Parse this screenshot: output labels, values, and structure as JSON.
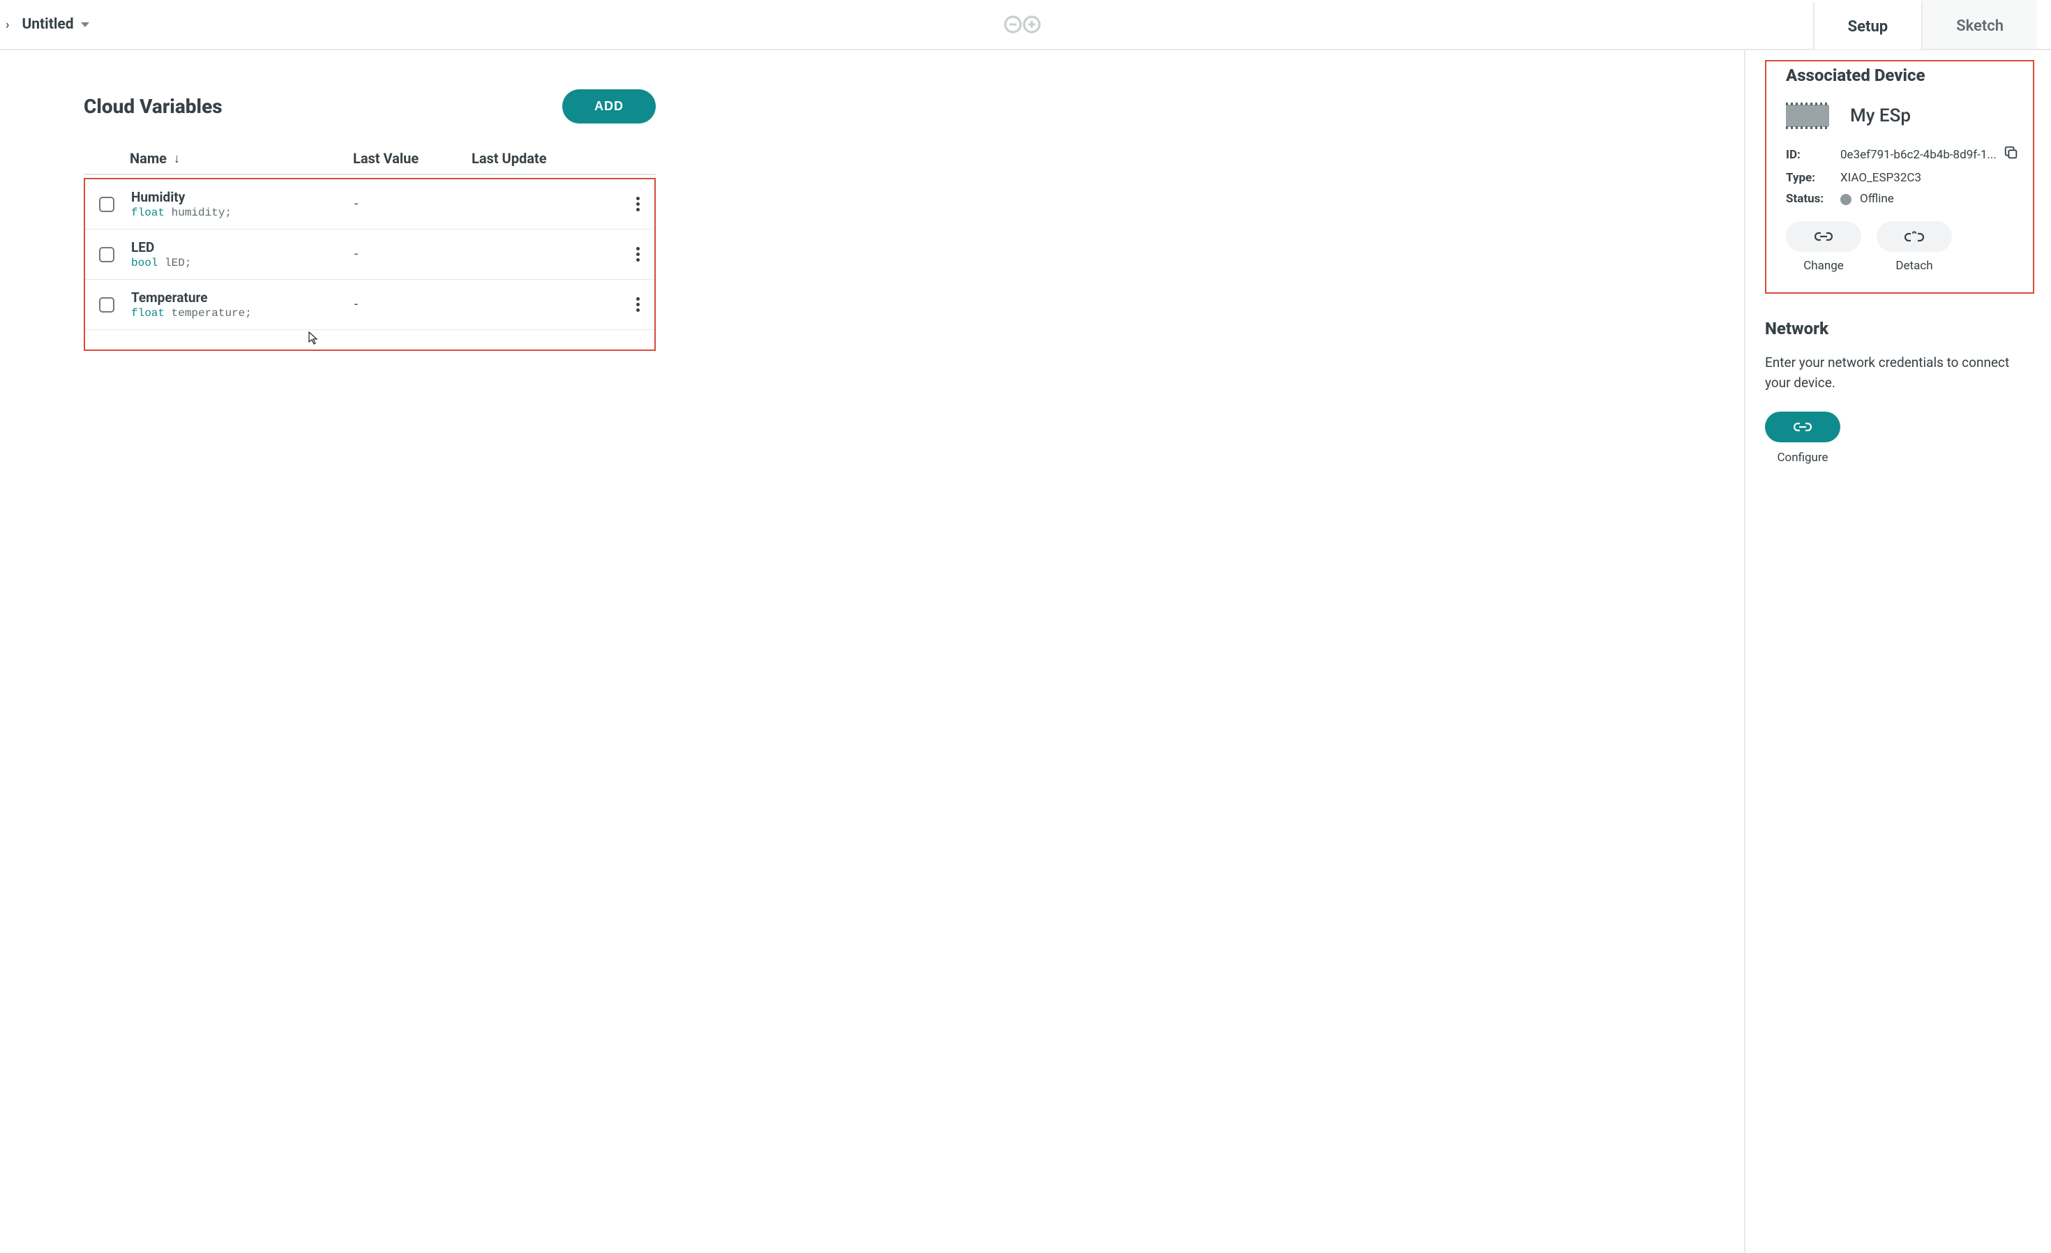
{
  "breadcrumb": {
    "title": "Untitled"
  },
  "tabs": {
    "setup": "Setup",
    "sketch": "Sketch"
  },
  "main": {
    "section_title": "Cloud Variables",
    "add_button": "ADD",
    "columns": {
      "name": "Name",
      "last_value": "Last Value",
      "last_update": "Last Update"
    },
    "variables": [
      {
        "name": "Humidity",
        "type": "float",
        "ident": "humidity;",
        "last_value": "-",
        "last_update": ""
      },
      {
        "name": "LED",
        "type": "bool",
        "ident": "lED;",
        "last_value": "-",
        "last_update": ""
      },
      {
        "name": "Temperature",
        "type": "float",
        "ident": "temperature;",
        "last_value": "-",
        "last_update": ""
      }
    ]
  },
  "device": {
    "section_title": "Associated Device",
    "name": "My ESp",
    "labels": {
      "id": "ID:",
      "type": "Type:",
      "status": "Status:"
    },
    "id": "0e3ef791-b6c2-4b4b-8d9f-1...",
    "type": "XIAO_ESP32C3",
    "status": "Offline",
    "actions": {
      "change": "Change",
      "detach": "Detach"
    }
  },
  "network": {
    "title": "Network",
    "text": "Enter your network credentials to connect your device.",
    "configure": "Configure"
  }
}
